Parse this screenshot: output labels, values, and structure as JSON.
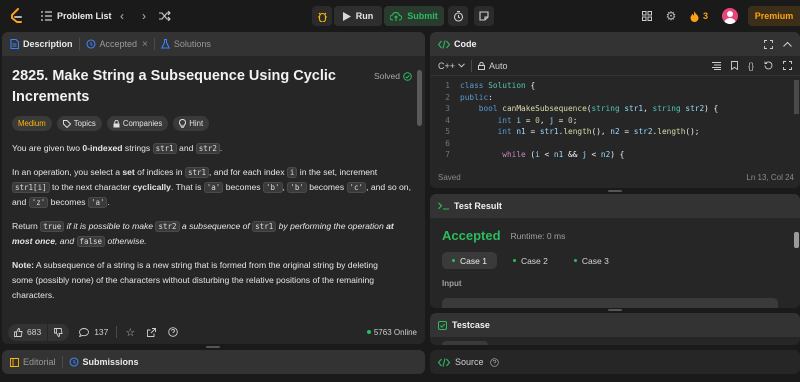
{
  "topbar": {
    "problem_list": "Problem List",
    "run": "Run",
    "submit": "Submit",
    "streak": "3",
    "premium": "Premium"
  },
  "left_tabs": {
    "description": "Description",
    "accepted": "Accepted",
    "solutions": "Solutions"
  },
  "problem": {
    "title": "2825. Make String a Subsequence Using Cyclic Increments",
    "solved": "Solved",
    "difficulty": "Medium",
    "tags": [
      "Topics",
      "Companies",
      "Hint"
    ],
    "p1": [
      "You are given two ",
      "0-indexed",
      " strings ",
      "str1",
      " and ",
      "str2",
      "."
    ],
    "p2a": [
      "In an operation, you select a ",
      "set",
      " of indices in ",
      "str1",
      ", and for each index ",
      "i",
      " in the set, increment"
    ],
    "p2b": [
      "str1[i]",
      " to the next character ",
      "cyclically",
      ". That is ",
      "'a'",
      " becomes ",
      "'b'",
      ", ",
      "'b'",
      " becomes ",
      "'c'",
      ", and so on,"
    ],
    "p2c": [
      "and ",
      "'z'",
      " becomes ",
      "'a'",
      "."
    ],
    "p3a": [
      "Return ",
      "true",
      " if it is possible to make ",
      "str2",
      " a subsequence of ",
      "str1",
      " by performing the operation ",
      "at"
    ],
    "p3b": [
      "most once",
      ", and ",
      "false",
      " otherwise."
    ],
    "p4a": [
      "Note:",
      " A subsequence of a string is a new string that is formed from the original string by deleting"
    ],
    "p4b": "some (possibly none) of the characters without disturbing the relative positions of the remaining",
    "p4c": "characters."
  },
  "footer_left": {
    "likes": "683",
    "comments": "137",
    "online": "5763 Online"
  },
  "bottom_tabs": {
    "editorial": "Editorial",
    "submissions": "Submissions"
  },
  "code_panel": {
    "title": "Code",
    "language": "C++",
    "mode": "Auto",
    "saved": "Saved",
    "cursor": "Ln 13, Col 24",
    "lines": [
      {
        "n": "1",
        "html": "<span class='kw'>class</span> <span class='ty'>Solution</span> {"
      },
      {
        "n": "2",
        "html": "<span class='kw'>public</span>:"
      },
      {
        "n": "3",
        "html": "    <span class='kw'>bool</span> <span class='fn'>canMakeSubsequence</span>(<span class='ty'>string</span> <span class='vr'>str1</span>, <span class='ty'>string</span> <span class='vr'>str2</span>) {"
      },
      {
        "n": "4",
        "html": "        <span class='kw'>int</span> <span class='vr'>i</span> = <span class='nm'>0</span>, <span class='vr'>j</span> = <span class='nm'>0</span>;"
      },
      {
        "n": "5",
        "html": "        <span class='kw'>int</span> <span class='vr'>n1</span> = <span class='vr'>str1</span>.<span class='fn'>length</span>(), <span class='vr'>n2</span> = <span class='vr'>str2</span>.<span class='fn'>length</span>();"
      },
      {
        "n": "6",
        "html": ""
      },
      {
        "n": "7",
        "html": "         <span class='cl'>while</span> (<span class='vr'>i</span> &lt; <span class='vr'>n1</span> &amp;&amp; <span class='vr'>j</span> &lt; <span class='vr'>n2</span>) {"
      }
    ]
  },
  "test_result": {
    "title": "Test Result",
    "status": "Accepted",
    "runtime": "Runtime: 0 ms",
    "cases": [
      "Case 1",
      "Case 2",
      "Case 3"
    ],
    "input_label": "Input"
  },
  "testcase": {
    "title": "Testcase"
  },
  "source": {
    "label": "Source"
  },
  "colors": {
    "accent_green": "#2cbb5d",
    "medium": "#ffb800",
    "premium": "#ffa116"
  }
}
